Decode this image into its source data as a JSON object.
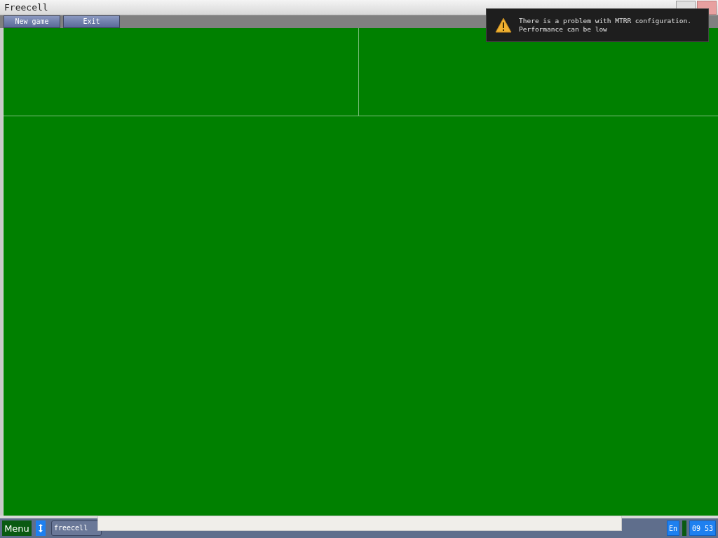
{
  "window": {
    "title": "Freecell"
  },
  "toolbar": {
    "buttons": [
      "New game",
      "Exit"
    ]
  },
  "notification": {
    "lines": [
      "There is a problem with MTRR configuration.",
      "Performance can be low"
    ]
  },
  "taskbar": {
    "menu": "Menu",
    "tasks": [
      {
        "label": "freecell",
        "selected": true
      }
    ],
    "language": "En",
    "clock": "09 53"
  }
}
